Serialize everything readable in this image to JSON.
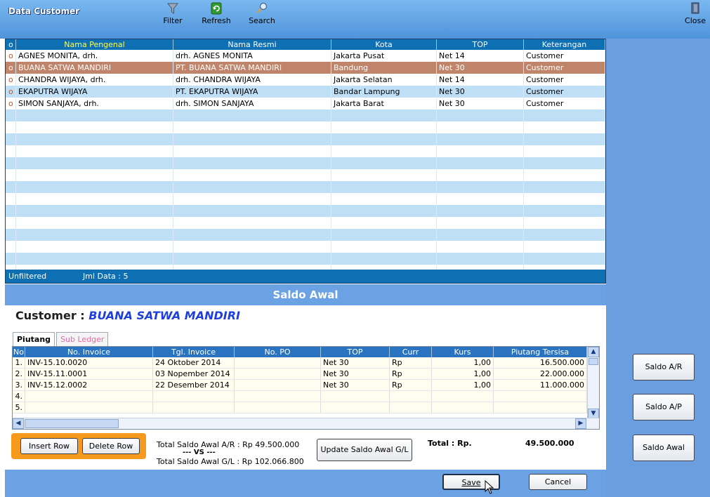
{
  "header": {
    "title": "Data Customer",
    "toolbar": [
      {
        "label": "Filter",
        "icon": "filter-icon"
      },
      {
        "label": "Refresh",
        "icon": "refresh-icon"
      },
      {
        "label": "Search",
        "icon": "search-icon"
      }
    ],
    "close_label": "Close"
  },
  "customers": {
    "columns": [
      "o",
      "Nama Pengenal",
      "Nama Resmi",
      "Kota",
      "TOP",
      "Keterangan"
    ],
    "rows": [
      {
        "marker": "o",
        "nama_pengenal": "AGNES MONITA, drh.",
        "nama_resmi": "drh. AGNES MONITA",
        "kota": "Jakarta Pusat",
        "top": "Net 14",
        "keterangan": "Customer"
      },
      {
        "marker": "o",
        "nama_pengenal": "BUANA SATWA MANDIRI",
        "nama_resmi": "PT. BUANA SATWA MANDIRI",
        "kota": "Bandung",
        "top": "Net 30",
        "keterangan": "Customer"
      },
      {
        "marker": "o",
        "nama_pengenal": "CHANDRA WIJAYA, drh.",
        "nama_resmi": "drh. CHANDRA WIJAYA",
        "kota": "Jakarta Selatan",
        "top": "Net 14",
        "keterangan": "Customer"
      },
      {
        "marker": "o",
        "nama_pengenal": "EKAPUTRA WIJAYA",
        "nama_resmi": "PT. EKAPUTRA WIJAYA",
        "kota": "Bandar Lampung",
        "top": "Net 30",
        "keterangan": "Customer"
      },
      {
        "marker": "o",
        "nama_pengenal": "SIMON SANJAYA, drh.",
        "nama_resmi": "drh. SIMON SANJAYA",
        "kota": "Jakarta Barat",
        "top": "Net 30",
        "keterangan": "Customer"
      }
    ],
    "selected_index": 1,
    "footer": {
      "filter_status": "Unfiltered",
      "count": "Jml Data : 5"
    }
  },
  "saldo_awal": {
    "title": "Saldo Awal",
    "customer_label": "Customer :",
    "customer_name": "BUANA SATWA MANDIRI",
    "tabs": [
      {
        "label": "Piutang",
        "active": true
      },
      {
        "label": "Sub Ledger",
        "active": false
      }
    ],
    "invoice_columns": [
      "No",
      "No. Invoice",
      "Tgl. Invoice",
      "No. PO",
      "TOP",
      "Curr",
      "Kurs",
      "Piutang Tersisa"
    ],
    "invoices": [
      {
        "no": "1.",
        "invoice": "INV-15.10.0020",
        "tgl": "24 Oktober 2014",
        "po": "",
        "top": "Net 30",
        "curr": "Rp",
        "kurs": "1,00",
        "piutang": "16.500.000"
      },
      {
        "no": "2.",
        "invoice": "INV-15.11.0001",
        "tgl": "03 Nopember 2014",
        "po": "",
        "top": "Net 30",
        "curr": "Rp",
        "kurs": "1,00",
        "piutang": "22.000.000"
      },
      {
        "no": "3.",
        "invoice": "INV-15.12.0002",
        "tgl": "22 Desember 2014",
        "po": "",
        "top": "Net 30",
        "curr": "Rp",
        "kurs": "1,00",
        "piutang": "11.000.000"
      },
      {
        "no": "4.",
        "invoice": "",
        "tgl": "",
        "po": "",
        "top": "",
        "curr": "",
        "kurs": "",
        "piutang": ""
      },
      {
        "no": "5.",
        "invoice": "",
        "tgl": "",
        "po": "",
        "top": "",
        "curr": "",
        "kurs": "",
        "piutang": ""
      }
    ],
    "insert_row": "Insert Row",
    "delete_row": "Delete Row",
    "total_ar": "Total Saldo Awal A/R : Rp 49.500.000",
    "vs": "--- VS ---",
    "total_gl": "Total Saldo Awal G/L : Rp 102.066.800",
    "update_btn": "Update Saldo Awal G/L",
    "total_label": "Total : Rp.",
    "total_value": "49.500.000",
    "save": "Save",
    "cancel": "Cancel"
  },
  "side_buttons": [
    "Saldo A/R",
    "Saldo A/P",
    "Saldo Awal"
  ],
  "colors": {
    "header": "#5a9de4",
    "grid_header": "#0e6fb3",
    "selected_row": "#c0846a",
    "stripe": "#bfdff6",
    "orange_panel": "#f59a1c"
  }
}
